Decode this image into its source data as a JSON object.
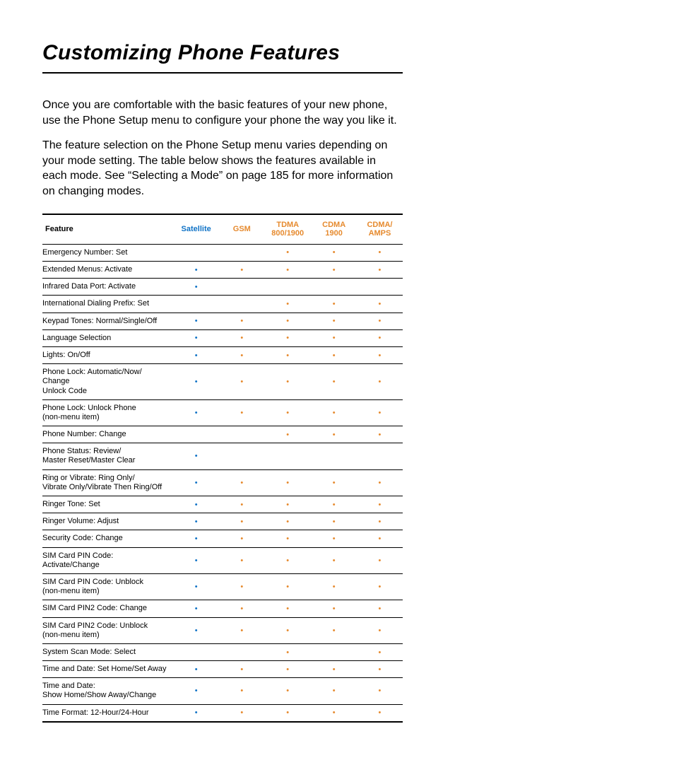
{
  "title": "Customizing Phone Features",
  "intro": [
    "Once you are comfortable with the basic features of your new phone, use the Phone Setup menu to configure your phone the way you like it.",
    "The feature selection on the Phone Setup menu varies depending on your mode setting. The table below shows the features available in each mode. See “Selecting a Mode” on page 185 for more information on changing modes."
  ],
  "table": {
    "headers": {
      "feature": "Feature",
      "satellite": "Satellite",
      "gsm": "GSM",
      "tdma": "TDMA\n800/1900",
      "cdma": "CDMA\n1900",
      "cdma_amps": "CDMA/\nAMPS"
    },
    "rows": [
      {
        "feature": "Emergency Number: Set",
        "satellite": false,
        "gsm": false,
        "tdma": true,
        "cdma": true,
        "cdma_amps": true
      },
      {
        "feature": "Extended Menus: Activate",
        "satellite": true,
        "gsm": true,
        "tdma": true,
        "cdma": true,
        "cdma_amps": true
      },
      {
        "feature": "Infrared Data Port: Activate",
        "satellite": true,
        "gsm": false,
        "tdma": false,
        "cdma": false,
        "cdma_amps": false
      },
      {
        "feature": "International Dialing Prefix: Set",
        "satellite": false,
        "gsm": false,
        "tdma": true,
        "cdma": true,
        "cdma_amps": true
      },
      {
        "feature": "Keypad Tones: Normal/Single/Off",
        "satellite": true,
        "gsm": true,
        "tdma": true,
        "cdma": true,
        "cdma_amps": true
      },
      {
        "feature": "Language Selection",
        "satellite": true,
        "gsm": true,
        "tdma": true,
        "cdma": true,
        "cdma_amps": true
      },
      {
        "feature": "Lights: On/Off",
        "satellite": true,
        "gsm": true,
        "tdma": true,
        "cdma": true,
        "cdma_amps": true
      },
      {
        "feature": "Phone Lock: Automatic/Now/ Change\nUnlock Code",
        "satellite": true,
        "gsm": true,
        "tdma": true,
        "cdma": true,
        "cdma_amps": true
      },
      {
        "feature": "Phone Lock: Unlock Phone\n(non-menu item)",
        "satellite": true,
        "gsm": true,
        "tdma": true,
        "cdma": true,
        "cdma_amps": true
      },
      {
        "feature": "Phone Number: Change",
        "satellite": false,
        "gsm": false,
        "tdma": true,
        "cdma": true,
        "cdma_amps": true
      },
      {
        "feature": "Phone Status: Review/\nMaster Reset/Master Clear",
        "satellite": true,
        "gsm": false,
        "tdma": false,
        "cdma": false,
        "cdma_amps": false
      },
      {
        "feature": "Ring or Vibrate: Ring Only/\nVibrate Only/Vibrate Then Ring/Off",
        "satellite": true,
        "gsm": true,
        "tdma": true,
        "cdma": true,
        "cdma_amps": true
      },
      {
        "feature": "Ringer Tone: Set",
        "satellite": true,
        "gsm": true,
        "tdma": true,
        "cdma": true,
        "cdma_amps": true
      },
      {
        "feature": "Ringer Volume: Adjust",
        "satellite": true,
        "gsm": true,
        "tdma": true,
        "cdma": true,
        "cdma_amps": true
      },
      {
        "feature": "Security Code: Change",
        "satellite": true,
        "gsm": true,
        "tdma": true,
        "cdma": true,
        "cdma_amps": true
      },
      {
        "feature": "SIM Card PIN Code:\nActivate/Change",
        "satellite": true,
        "gsm": true,
        "tdma": true,
        "cdma": true,
        "cdma_amps": true
      },
      {
        "feature": "SIM Card PIN Code: Unblock\n(non-menu item)",
        "satellite": true,
        "gsm": true,
        "tdma": true,
        "cdma": true,
        "cdma_amps": true
      },
      {
        "feature": "SIM Card PIN2 Code: Change",
        "satellite": true,
        "gsm": true,
        "tdma": true,
        "cdma": true,
        "cdma_amps": true
      },
      {
        "feature": "SIM Card PIN2 Code: Unblock\n(non-menu item)",
        "satellite": true,
        "gsm": true,
        "tdma": true,
        "cdma": true,
        "cdma_amps": true
      },
      {
        "feature": "System Scan Mode: Select",
        "satellite": false,
        "gsm": false,
        "tdma": true,
        "cdma": false,
        "cdma_amps": true
      },
      {
        "feature": "Time and Date: Set Home/Set Away",
        "satellite": true,
        "gsm": true,
        "tdma": true,
        "cdma": true,
        "cdma_amps": true
      },
      {
        "feature": "Time and Date:\nShow Home/Show Away/Change",
        "satellite": true,
        "gsm": true,
        "tdma": true,
        "cdma": true,
        "cdma_amps": true
      },
      {
        "feature": "Time Format: 12-Hour/24-Hour",
        "satellite": true,
        "gsm": true,
        "tdma": true,
        "cdma": true,
        "cdma_amps": true
      }
    ]
  }
}
